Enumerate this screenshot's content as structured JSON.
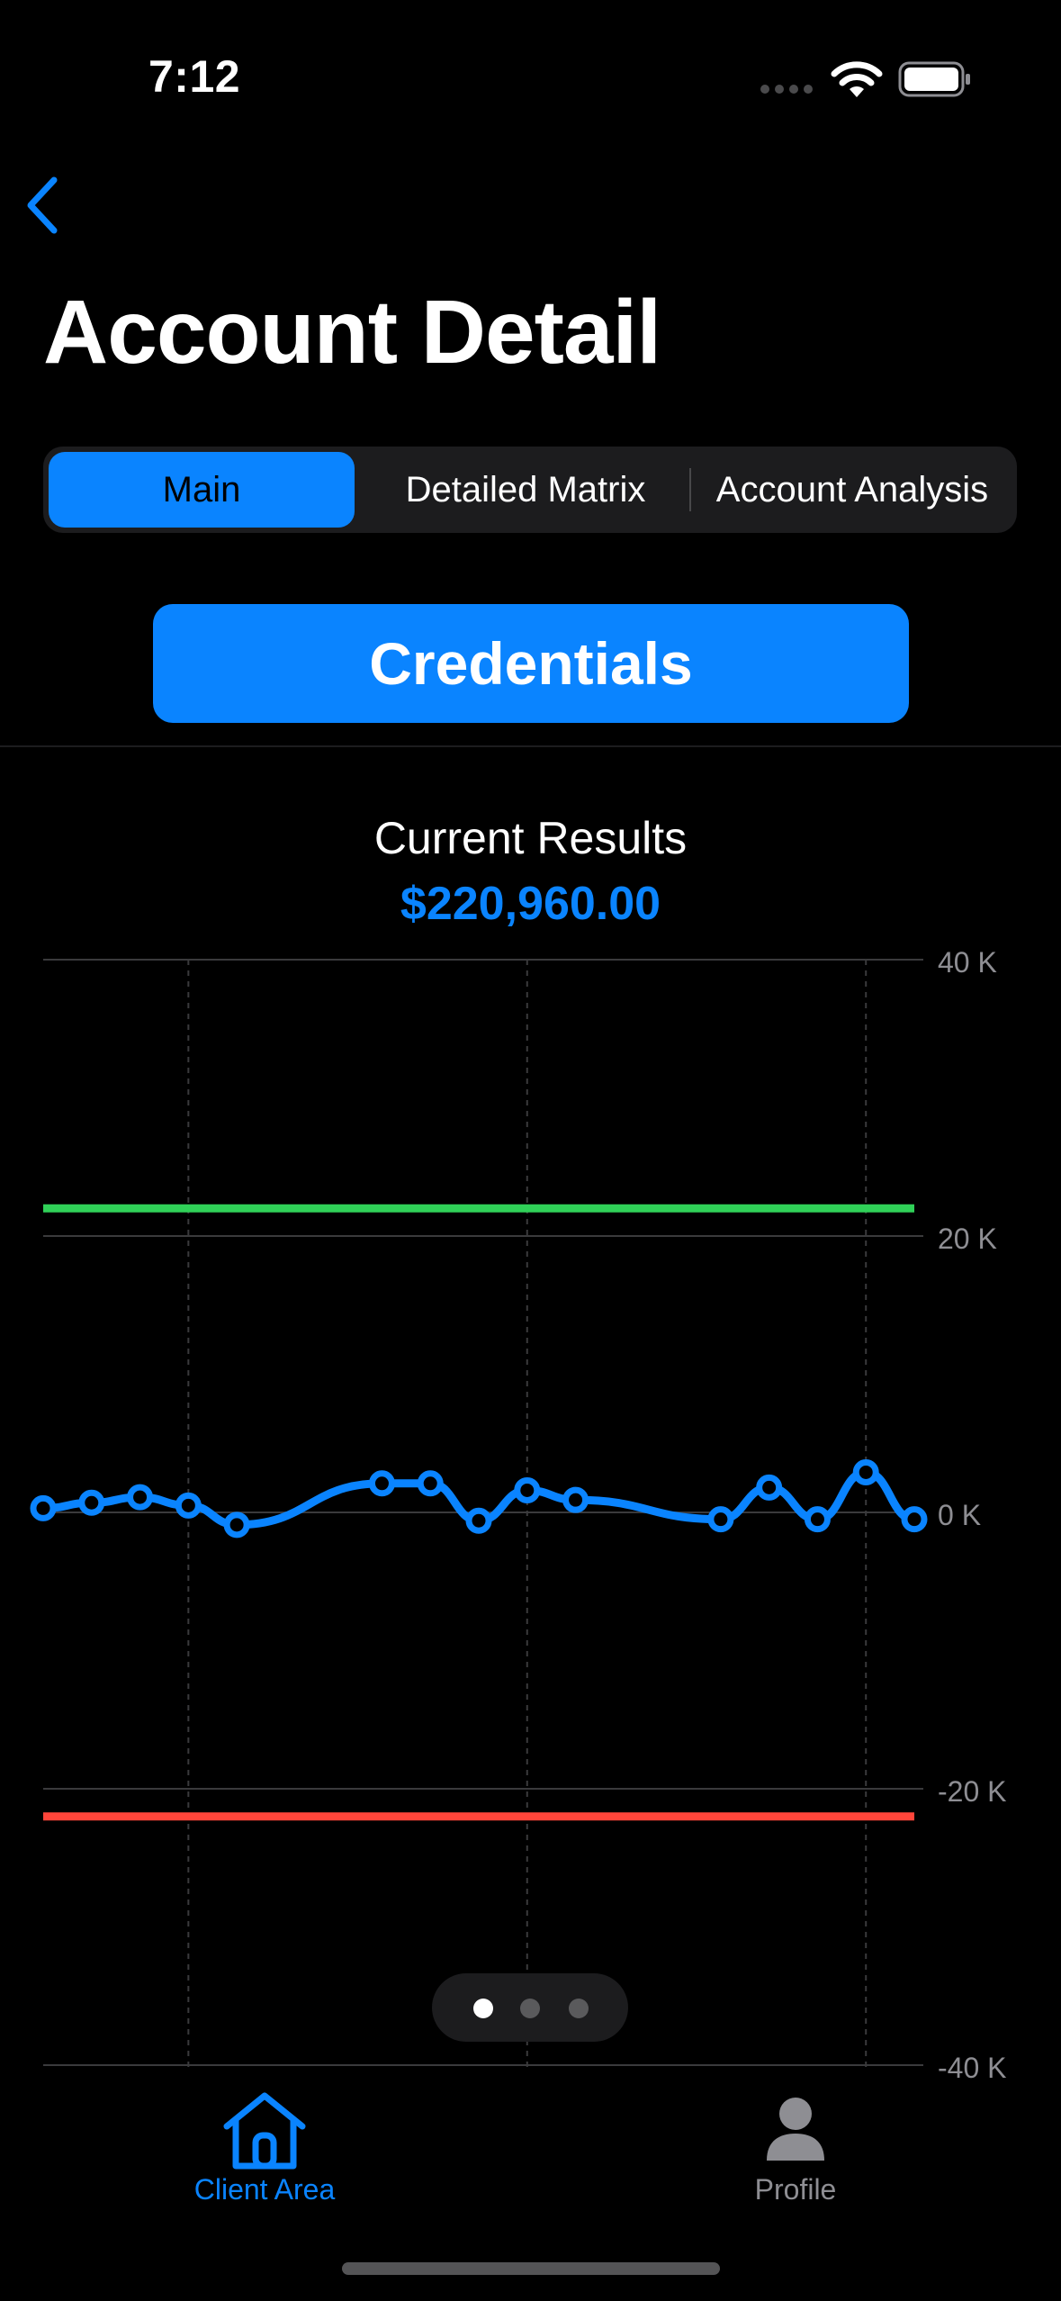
{
  "status_bar": {
    "time": "7:12"
  },
  "header": {
    "title": "Account Detail"
  },
  "tabs": [
    {
      "label": "Main",
      "selected": true
    },
    {
      "label": "Detailed Matrix",
      "selected": false
    },
    {
      "label": "Account Analysis",
      "selected": false
    }
  ],
  "credentials_button": {
    "label": "Credentials"
  },
  "results": {
    "label": "Current Results",
    "value": "$220,960.00"
  },
  "chart_data": {
    "type": "line",
    "ylim": [
      -40000,
      40000
    ],
    "y_ticks": [
      40000,
      20000,
      0,
      -20000,
      -40000
    ],
    "y_tick_labels": [
      "40 K",
      "20 K",
      "0 K",
      "-20 K",
      "-40 K"
    ],
    "grid": true,
    "series": [
      {
        "values": [
          300,
          700,
          1100,
          500,
          -900,
          2100,
          2100,
          -600,
          1600,
          900,
          -500,
          1800,
          -500,
          2900,
          -500
        ],
        "x": [
          0,
          1,
          2,
          3,
          4,
          7,
          8,
          9,
          10,
          11,
          14,
          15,
          16,
          17,
          18
        ],
        "color": "#0a84ff"
      }
    ],
    "thresholds": [
      {
        "value": 22000,
        "color": "#30d158"
      },
      {
        "value": -22000,
        "color": "#ff453a"
      }
    ]
  },
  "page_indicator": {
    "count": 3,
    "current": 0
  },
  "tab_bar": [
    {
      "label": "Client Area",
      "icon": "house-icon",
      "selected": true
    },
    {
      "label": "Profile",
      "icon": "person-icon",
      "selected": false
    }
  ],
  "colors": {
    "accent": "#0a84ff",
    "background": "#000000",
    "inactive": "#8e8e93"
  }
}
